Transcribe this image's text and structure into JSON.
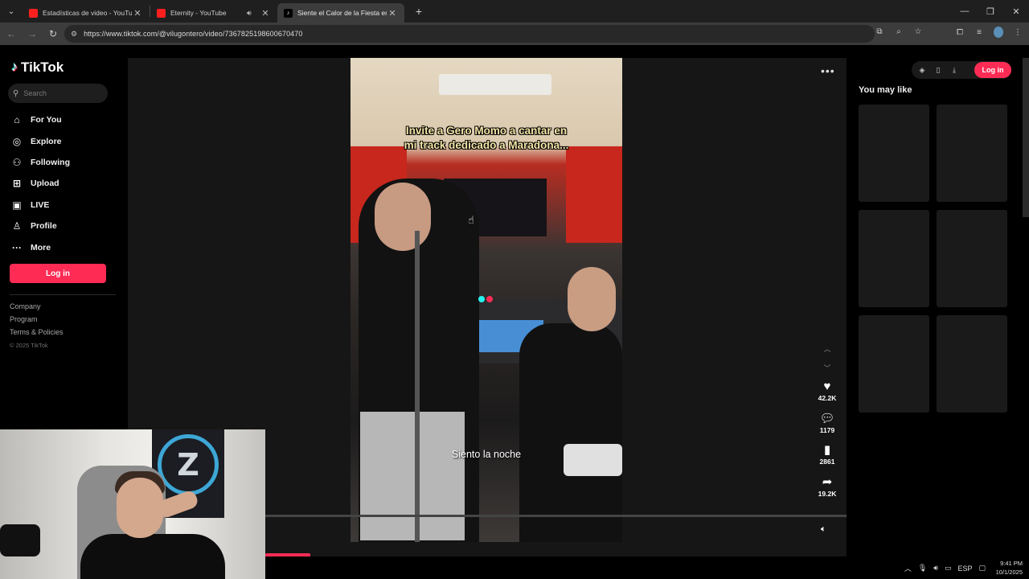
{
  "browser": {
    "tabs": [
      {
        "title": "Estadísticas de video - YouTube",
        "favicon": "youtube-icon"
      },
      {
        "title": "Eternity - YouTube",
        "favicon": "youtube-icon"
      },
      {
        "title": "Siente el Calor de la Fiesta en A",
        "favicon": "tiktok-icon"
      }
    ],
    "url": "https://www.tiktok.com/@vilugontero/video/7367825198600670470"
  },
  "sidebar": {
    "logo": "TikTok",
    "search_placeholder": "Search",
    "nav": [
      {
        "label": "For You",
        "icon": "home-icon"
      },
      {
        "label": "Explore",
        "icon": "compass-icon"
      },
      {
        "label": "Following",
        "icon": "following-icon"
      },
      {
        "label": "Upload",
        "icon": "upload-icon"
      },
      {
        "label": "LIVE",
        "icon": "live-icon"
      },
      {
        "label": "Profile",
        "icon": "profile-icon"
      },
      {
        "label": "More",
        "icon": "more-icon"
      }
    ],
    "login_label": "Log in",
    "footer": [
      "Company",
      "Program",
      "Terms & Policies"
    ],
    "copyright": "© 2025 TikTok"
  },
  "video": {
    "caption": "Invite a Gero Momo a cantar en mi track dedicado a Maradona...",
    "subtitle": "Siento la noche",
    "actions": [
      {
        "icon": "heart-icon",
        "count": "42.2K"
      },
      {
        "icon": "comment-icon",
        "count": "1179"
      },
      {
        "icon": "bookmark-icon",
        "count": "2861"
      },
      {
        "icon": "share-icon",
        "count": "19.2K"
      }
    ]
  },
  "right_panel": {
    "login_label": "Log in",
    "title": "You may like"
  },
  "taskbar": {
    "language": "ESP",
    "time": "9:41 PM",
    "date": "10/1/2025"
  },
  "colors": {
    "accent": "#fe2c55",
    "tiktok_cyan": "#25f4ee"
  }
}
